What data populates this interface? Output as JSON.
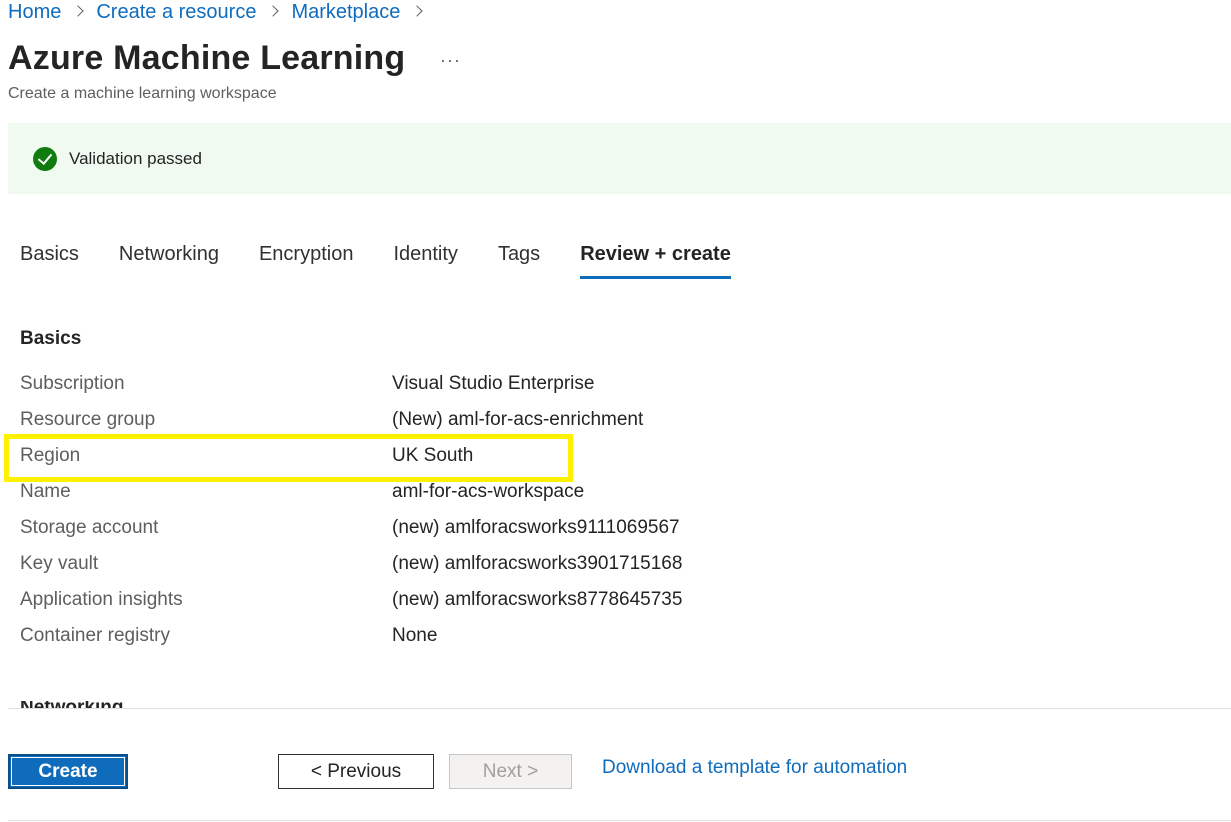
{
  "breadcrumb": {
    "items": [
      "Home",
      "Create a resource",
      "Marketplace"
    ]
  },
  "header": {
    "title": "Azure Machine Learning",
    "more_icon": "ellipsis-icon",
    "subtitle": "Create a machine learning workspace"
  },
  "validation": {
    "icon": "check-circle-icon",
    "text": "Validation passed",
    "color": "#107c10"
  },
  "tabs": [
    {
      "label": "Basics",
      "active": false
    },
    {
      "label": "Networking",
      "active": false
    },
    {
      "label": "Encryption",
      "active": false
    },
    {
      "label": "Identity",
      "active": false
    },
    {
      "label": "Tags",
      "active": false
    },
    {
      "label": "Review + create",
      "active": true
    }
  ],
  "basics": {
    "heading": "Basics",
    "rows": [
      {
        "label": "Subscription",
        "value": "Visual Studio Enterprise"
      },
      {
        "label": "Resource group",
        "value": "(New) aml-for-acs-enrichment"
      },
      {
        "label": "Region",
        "value": "UK South"
      },
      {
        "label": "Name",
        "value": "aml-for-acs-workspace"
      },
      {
        "label": "Storage account",
        "value": "(new) amlforacsworks9111069567"
      },
      {
        "label": "Key vault",
        "value": "(new) amlforacsworks3901715168"
      },
      {
        "label": "Application insights",
        "value": "(new) amlforacsworks8778645735"
      },
      {
        "label": "Container registry",
        "value": "None"
      }
    ]
  },
  "next_section": {
    "heading": "Networking"
  },
  "footer": {
    "create_label": "Create",
    "previous_label": "< Previous",
    "next_label": "Next >",
    "download_label": "Download a template for automation"
  },
  "colors": {
    "accent": "#0f6cbd",
    "highlight": "#fff200",
    "banner_bg": "#f1faf1"
  }
}
